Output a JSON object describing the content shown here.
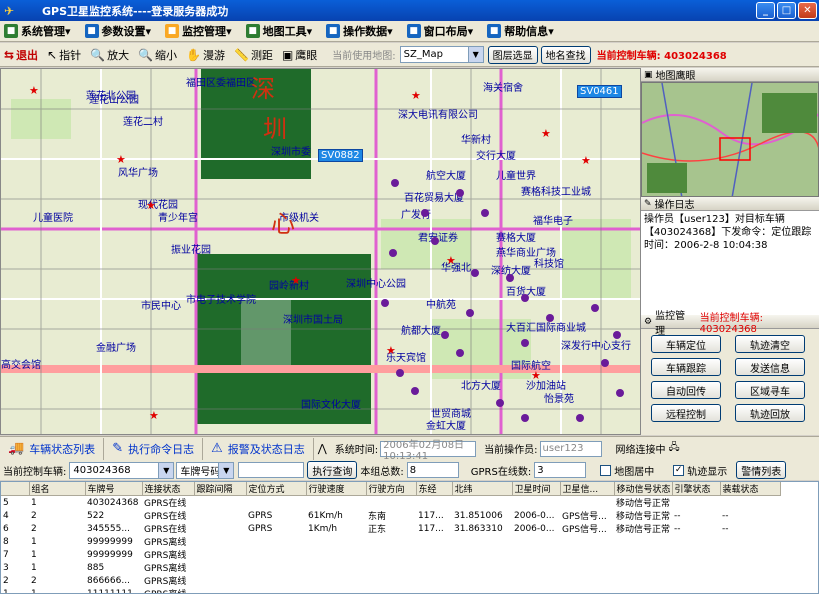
{
  "window": {
    "title": "GPS卫星监控系统----登录服务器成功"
  },
  "menu": [
    {
      "label": "系统管理",
      "icon": "system-icon",
      "color": "#2e7d32"
    },
    {
      "label": "参数设置",
      "icon": "settings-icon",
      "color": "#1565c0"
    },
    {
      "label": "监控管理",
      "icon": "monitor-icon",
      "color": "#f9a825"
    },
    {
      "label": "地图工具",
      "icon": "map-tool-icon",
      "color": "#2e7d32"
    },
    {
      "label": "操作数据",
      "icon": "data-icon",
      "color": "#1565c0"
    },
    {
      "label": "窗口布局",
      "icon": "window-icon",
      "color": "#1565c0"
    },
    {
      "label": "帮助信息",
      "icon": "help-icon",
      "color": "#1565c0"
    }
  ],
  "toolbar": {
    "tools": [
      {
        "label": "退出",
        "icon": "exit-icon",
        "glyph": "⇆"
      },
      {
        "label": "指针",
        "icon": "pointer-icon",
        "glyph": "↖"
      },
      {
        "label": "放大",
        "icon": "zoom-in-icon",
        "glyph": "🔍"
      },
      {
        "label": "缩小",
        "icon": "zoom-out-icon",
        "glyph": "🔍"
      },
      {
        "label": "漫游",
        "icon": "pan-hand-icon",
        "glyph": "✋"
      },
      {
        "label": "测距",
        "icon": "ruler-icon",
        "glyph": "📏"
      },
      {
        "label": "鹰眼",
        "icon": "eagle-eye-icon",
        "glyph": "▣"
      }
    ],
    "map_label": "当前使用地图:",
    "map_value": "SZ_Map",
    "layer_button": "图层选显",
    "search_button": "地名查找",
    "control_label": "当前控制车辆: 403024368"
  },
  "map": {
    "labels": [
      "莲花北公园",
      "莲花二村",
      "莲花山公园",
      "福田区委福田区",
      "风华广场",
      "现代花园",
      "青少年宫",
      "儿童医院",
      "振业花园",
      "市民中心",
      "市电子技术学院",
      "高交会馆",
      "金融广场",
      "深圳市委",
      "市级机关",
      "园岭新村",
      "海关宿舍",
      "深大电讯有限公司",
      "华新村",
      "交行大厦",
      "航空大厦",
      "儿童世界",
      "百花贸易大厦",
      "赛格科技工业城",
      "福华电子",
      "广发行",
      "君安证券",
      "赛格大厦",
      "燕华商业广场",
      "科技馆",
      "华强北",
      "深纺大厦",
      "百货大厦",
      "中航苑",
      "深圳中心公园",
      "深圳市国土局",
      "国际文化大厦",
      "北方大厦",
      "沙加油站",
      "怡景苑",
      "世贸商城",
      "金虹大厦",
      "乐天宾馆",
      "大百汇国际商业城",
      "深发行中心支行",
      "航都大厦",
      "国际航空"
    ],
    "big_texts": [
      "深",
      "圳",
      "心"
    ],
    "vehicles": [
      "SV0882",
      "SV0461"
    ]
  },
  "eagle_panel": {
    "title": "地图鹰眼"
  },
  "log_panel": {
    "title": "操作日志",
    "lines": [
      "操作员【user123】对目标车辆",
      "【403024368】下发命令：定位跟踪",
      "时间：2006-2-8 10:04:38"
    ]
  },
  "control_panel": {
    "title": "监控管理",
    "target": "当前控制车辆: 403024368",
    "buttons": [
      "车辆定位",
      "轨迹清空",
      "车辆跟踪",
      "发送信息",
      "自动回传",
      "区域寻车",
      "远程控制",
      "轨迹回放"
    ]
  },
  "tabs": [
    {
      "label": "车辆状态列表",
      "icon": "vehicle-list-icon"
    },
    {
      "label": "执行命令日志",
      "icon": "command-log-icon"
    },
    {
      "label": "报警及状态日志",
      "icon": "alarm-log-icon"
    }
  ],
  "status": {
    "time_label": "系统时间:",
    "time_value": "2006年02月08日 10:13:41",
    "operator_label": "当前操作员:",
    "operator_value": "user123",
    "network": "网络连接中"
  },
  "filter": {
    "control_label": "当前控制车辆:",
    "control_value": "403024368",
    "type_value": "车牌号码",
    "query_button": "执行查询",
    "total_label": "本组总数:",
    "total_value": "8",
    "online_label": "GPRS在线数:",
    "online_value": "3",
    "center_label": "地图居中",
    "track_label": "轨迹显示",
    "alarm_button": "警情列表"
  },
  "table": {
    "headers": [
      "组名",
      "车牌号",
      "连接状态",
      "跟踪间隔",
      "定位方式",
      "行驶速度",
      "行驶方向",
      "东经",
      "北纬",
      "卫星时间",
      "卫星信...",
      "移动信号状态",
      "引擎状态",
      "装载状态"
    ],
    "rows": [
      [
        "5",
        "1",
        "403024368",
        "GPRS在线",
        "",
        "",
        "",
        "",
        "",
        "",
        "",
        "",
        "移动信号正常",
        "",
        ""
      ],
      [
        "4",
        "2",
        "522",
        "GPRS在线",
        "",
        "GPRS",
        "61Km/h",
        "东南",
        "117...",
        "31.851006",
        "2006-0...",
        "GPS信号...",
        "移动信号正常",
        "--",
        "--"
      ],
      [
        "6",
        "2",
        "345555...",
        "GPRS在线",
        "",
        "GPRS",
        "1Km/h",
        "正东",
        "117...",
        "31.863310",
        "2006-0...",
        "GPS信号...",
        "移动信号正常",
        "--",
        "--"
      ],
      [
        "8",
        "1",
        "99999999",
        "GPRS离线",
        "",
        "",
        "",
        "",
        "",
        "",
        "",
        "",
        "",
        "",
        ""
      ],
      [
        "7",
        "1",
        "99999999",
        "GPRS离线",
        "",
        "",
        "",
        "",
        "",
        "",
        "",
        "",
        "",
        "",
        ""
      ],
      [
        "3",
        "1",
        "885",
        "GPRS离线",
        "",
        "",
        "",
        "",
        "",
        "",
        "",
        "",
        "",
        "",
        ""
      ],
      [
        "2",
        "2",
        "866666...",
        "GPRS离线",
        "",
        "",
        "",
        "",
        "",
        "",
        "",
        "",
        "",
        "",
        ""
      ],
      [
        "1",
        "1",
        "11111111",
        "GPRS离线",
        "",
        "",
        "",
        "",
        "",
        "",
        "",
        "",
        "",
        "",
        ""
      ]
    ]
  },
  "colors": {
    "accent": "#0a5fd8",
    "alert_red": "#e00000"
  }
}
